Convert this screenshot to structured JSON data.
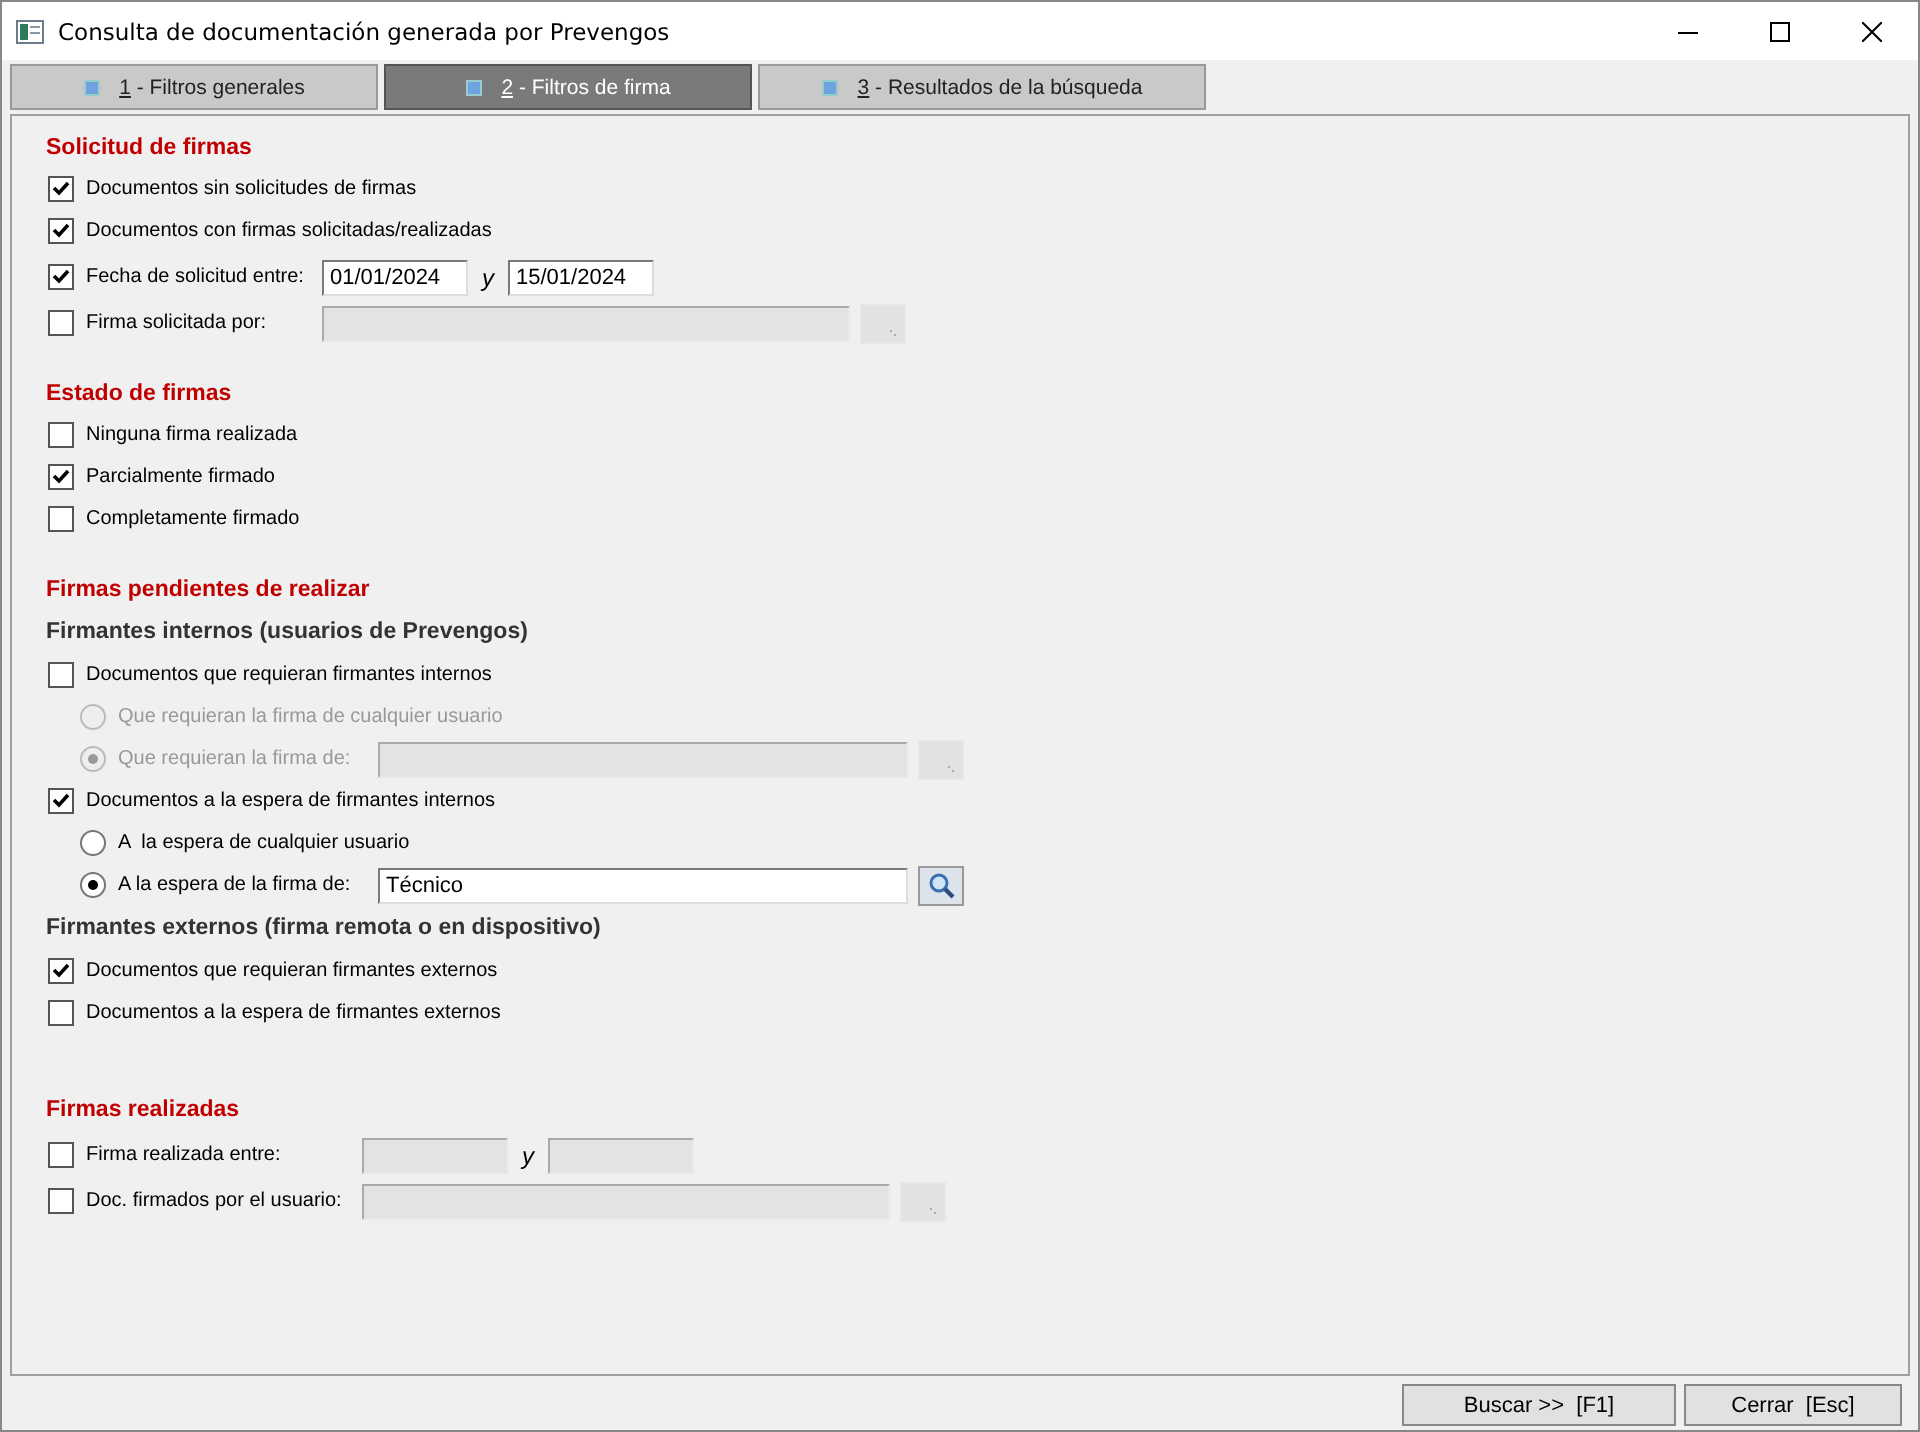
{
  "window": {
    "title": "Consulta de documentación generada por Prevengos"
  },
  "tabs": [
    {
      "key": "1",
      "label": "- Filtros generales",
      "selected": false
    },
    {
      "key": "2",
      "label": "- Filtros de firma",
      "selected": true
    },
    {
      "key": "3",
      "label": "- Resultados de la búsqueda",
      "selected": false
    }
  ],
  "sections": [
    {
      "title": "Solicitud de firmas",
      "items": [
        {
          "kind": "check",
          "label": "Documentos sin solicitudes de firmas",
          "checked": true
        },
        {
          "kind": "check",
          "label": "Documentos con firmas solicitadas/realizadas",
          "checked": true
        },
        {
          "kind": "check",
          "label": "Fecha de solicitud entre:",
          "checked": true,
          "range": {
            "from": "01/01/2024",
            "separator": "y",
            "to": "15/01/2024",
            "disabled": false
          }
        },
        {
          "kind": "check",
          "label": "Firma solicitada por:",
          "checked": false,
          "lookup": {
            "disabled": true,
            "kind": "dots"
          }
        }
      ]
    },
    {
      "title": "Estado de firmas",
      "items": [
        {
          "kind": "check",
          "label": "Ninguna firma realizada",
          "checked": false
        },
        {
          "kind": "check",
          "label": "Parcialmente firmado",
          "checked": true
        },
        {
          "kind": "check",
          "label": "Completamente firmado",
          "checked": false
        }
      ]
    },
    {
      "title": "Firmas pendientes de realizar",
      "items": [
        {
          "kind": "subheading",
          "label": "Firmantes internos (usuarios de Prevengos)"
        },
        {
          "kind": "check",
          "label": "Documentos que requieran firmantes internos",
          "checked": false,
          "children": [
            {
              "kind": "radio",
              "label": "Que requieran la firma de cualquier usuario",
              "selected": false,
              "disabled": true
            },
            {
              "kind": "radio",
              "label": "Que requieran la firma de:",
              "selected": true,
              "disabled": true,
              "lookup": {
                "disabled": true,
                "kind": "dots"
              }
            }
          ]
        },
        {
          "kind": "check",
          "label": "Documentos a la espera de firmantes internos",
          "checked": true,
          "children": [
            {
              "kind": "radio",
              "label": "A  la espera de cualquier usuario",
              "selected": false,
              "disabled": false
            },
            {
              "kind": "radio",
              "label": "A la espera de la firma de:",
              "selected": true,
              "disabled": false,
              "lookup": {
                "value": "Técnico",
                "disabled": false,
                "kind": "search"
              }
            }
          ]
        },
        {
          "kind": "subheading",
          "label": "Firmantes externos (firma remota o en dispositivo)"
        },
        {
          "kind": "check",
          "label": "Documentos que requieran firmantes externos",
          "checked": true
        },
        {
          "kind": "check",
          "label": "Documentos a la espera de firmantes externos",
          "checked": false
        }
      ]
    },
    {
      "title": "Firmas realizadas",
      "items": [
        {
          "kind": "check",
          "label": "Firma realizada entre:",
          "checked": false,
          "range": {
            "separator": "y",
            "disabled": true
          }
        },
        {
          "kind": "check",
          "label": "Doc. firmados por el usuario:",
          "checked": false,
          "lookup": {
            "disabled": true,
            "kind": "dots"
          }
        }
      ]
    }
  ],
  "buttons": [
    {
      "label": "Buscar >>  [F1]"
    },
    {
      "label": "Cerrar  [Esc]"
    }
  ]
}
